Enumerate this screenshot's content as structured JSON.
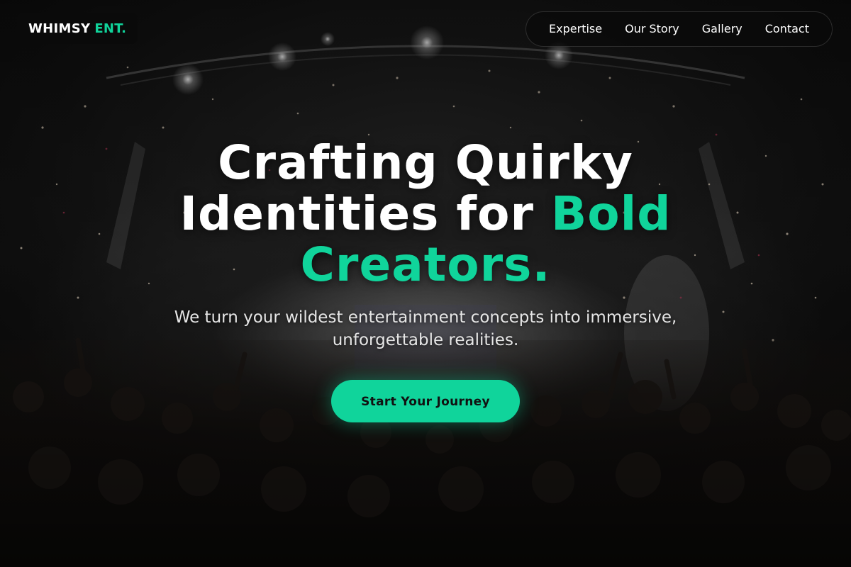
{
  "brand": {
    "name": "WHIMSY",
    "accent": "ENT.",
    "accent_color": "#10d49b"
  },
  "nav": {
    "items": [
      {
        "label": "Expertise"
      },
      {
        "label": "Our Story"
      },
      {
        "label": "Gallery"
      },
      {
        "label": "Contact"
      }
    ]
  },
  "hero": {
    "headline_line1": "Crafting Quirky",
    "headline_line2_plain": "Identities for ",
    "headline_line2_highlight": "Bold",
    "headline_line3_highlight": "Creators.",
    "subtitle_line1": "We turn your wildest entertainment concepts into immersive,",
    "subtitle_line2": "unforgettable realities.",
    "cta_label": "Start Your Journey",
    "background": "concert-crowd-image"
  },
  "colors": {
    "accent": "#10d49b",
    "background": "#0b0b0b",
    "text": "#ffffff"
  }
}
